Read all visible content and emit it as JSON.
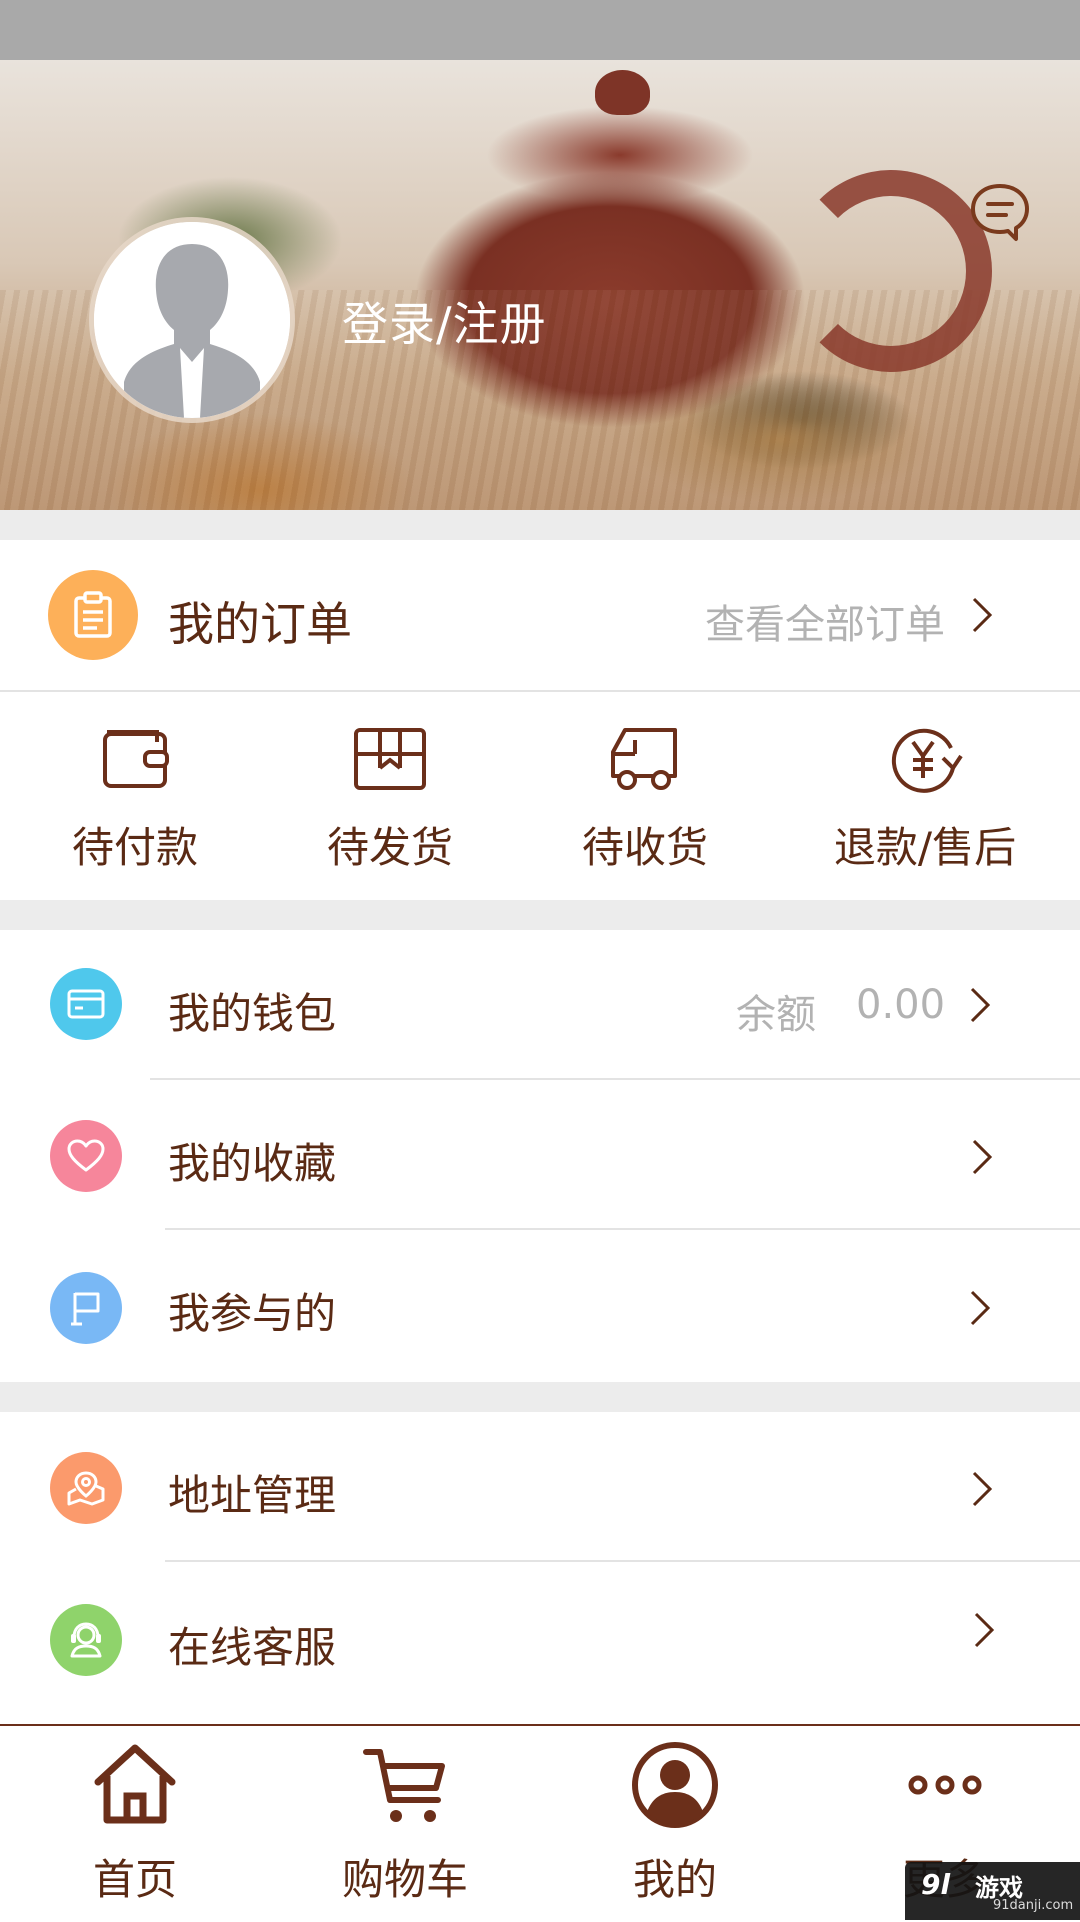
{
  "header": {
    "login_label": "登录/注册"
  },
  "orders": {
    "title": "我的订单",
    "view_all": "查看全部订单",
    "statuses": [
      {
        "label": "待付款"
      },
      {
        "label": "待发货"
      },
      {
        "label": "待收货"
      },
      {
        "label": "退款/售后"
      }
    ]
  },
  "menu_group1": [
    {
      "label": "我的钱包",
      "balance_label": "余额",
      "balance_value": "0.00",
      "color": "#4fc8ec"
    },
    {
      "label": "我的收藏",
      "color": "#f6869b"
    },
    {
      "label": "我参与的",
      "color": "#79b8f5"
    }
  ],
  "menu_group2": [
    {
      "label": "地址管理",
      "color": "#fb9a6c"
    },
    {
      "label": "在线客服",
      "color": "#8fd36b"
    }
  ],
  "tabbar": [
    {
      "label": "首页"
    },
    {
      "label": "购物车"
    },
    {
      "label": "我的"
    },
    {
      "label": "更多"
    }
  ],
  "watermark": {
    "logo": "9l",
    "main": "游戏",
    "sub": "91danji.com"
  },
  "colors": {
    "accent": "#6b2f1a",
    "order_icon": "#fdb059",
    "status_bar": "#a9a9a9"
  }
}
